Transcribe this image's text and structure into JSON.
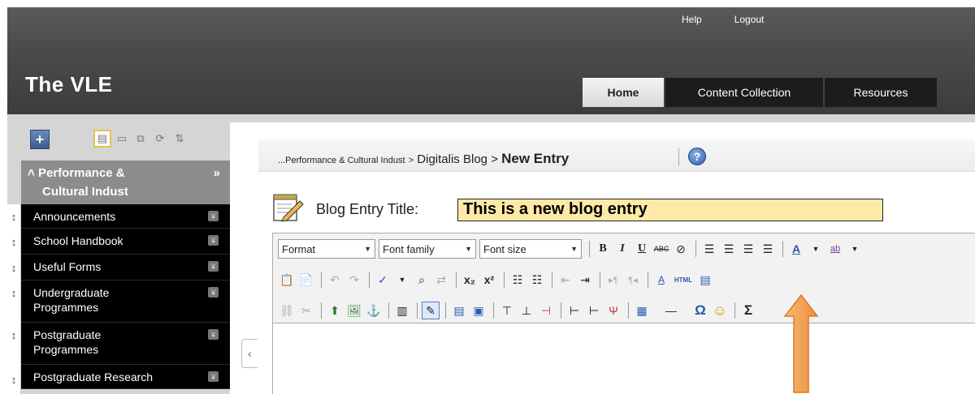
{
  "header": {
    "links": [
      "Help",
      "Logout"
    ],
    "site_title": "The VLE",
    "tabs": [
      {
        "label": "Home",
        "active": true
      },
      {
        "label": "Content Collection",
        "active": false
      },
      {
        "label": "Resources",
        "active": false
      }
    ]
  },
  "sidebar": {
    "course_line1": "Performance &",
    "course_line2": "Cultural Indust",
    "course_prefix_icon": "chevron-up-icon",
    "course_expand_icon": "double-chevron-right-icon",
    "items": [
      {
        "label": "Announcements"
      },
      {
        "label": "School Handbook"
      },
      {
        "label": "Useful Forms"
      },
      {
        "label": "Undergraduate Programmes"
      },
      {
        "label": "Postgraduate Programmes"
      },
      {
        "label": "Postgraduate Research"
      }
    ]
  },
  "breadcrumb": {
    "part1": "...Performance & Cultural Indust",
    "sep": ">",
    "part2": "Digitalis Blog",
    "current": "New Entry"
  },
  "entry": {
    "label": "Blog Entry Title:",
    "title_value": "This is a new blog entry"
  },
  "editor": {
    "format_label": "Format",
    "font_family_label": "Font family",
    "font_size_label": "Font size",
    "html_button": "HTML",
    "omega": "Ω",
    "sigma": "Σ"
  },
  "colors": {
    "header": "#4b4b4b",
    "title_input_bg": "#fde9a8",
    "arrow": "#f4a460"
  }
}
